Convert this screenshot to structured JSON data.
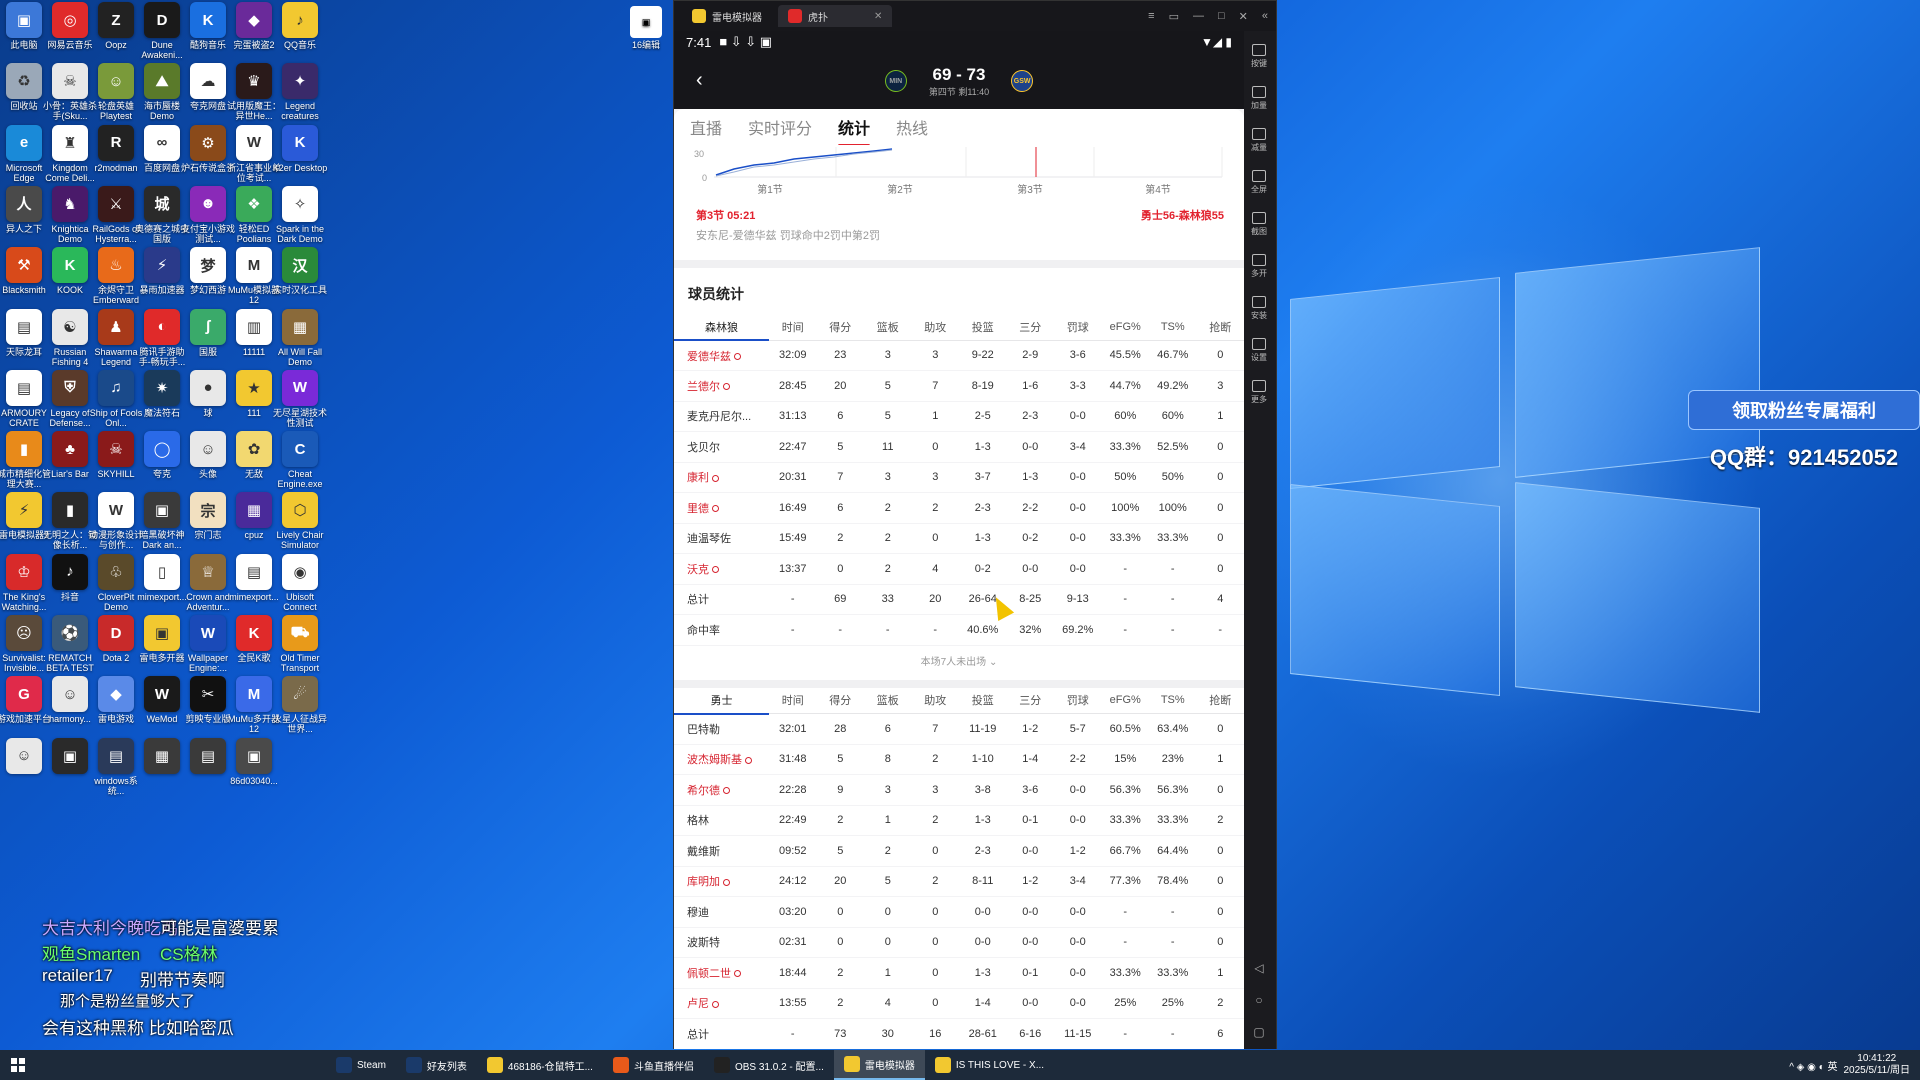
{
  "desktop": {
    "icons": [
      {
        "label": "此电脑",
        "color": "#3c78d8",
        "glyph": "▣"
      },
      {
        "label": "网易云音乐",
        "color": "#e02a2a",
        "glyph": "◎"
      },
      {
        "label": "Oopz",
        "color": "#222222",
        "glyph": "Z"
      },
      {
        "label": "Dune Awakeni...",
        "color": "#1a1a1a",
        "glyph": "D"
      },
      {
        "label": "酷狗音乐",
        "color": "#1a6fe0",
        "glyph": "K"
      },
      {
        "label": "完蛋被盗2",
        "color": "#6a2a9a",
        "glyph": "◆"
      },
      {
        "label": "QQ音乐",
        "color": "#f2c830",
        "glyph": "♪"
      },
      {
        "label": "回收站",
        "color": "#9aa8b8",
        "glyph": "♻"
      },
      {
        "label": "小骨：英雄杀手(Sku...",
        "color": "#e8e8e8",
        "glyph": "☠"
      },
      {
        "label": "轮盘英雄 Playtest",
        "color": "#7a9a3a",
        "glyph": "☺"
      },
      {
        "label": "海市蜃楼 Demo",
        "color": "#5a7a2a",
        "glyph": "⛰"
      },
      {
        "label": "夸克网盘",
        "color": "#ffffff",
        "glyph": "☁"
      },
      {
        "label": "试用版魔王：异世He...",
        "color": "#2a1a1a",
        "glyph": "♛"
      },
      {
        "label": "Legend creatures",
        "color": "#3a2a6a",
        "glyph": "✦"
      },
      {
        "label": "Microsoft Edge",
        "color": "#1a8ad8",
        "glyph": "e"
      },
      {
        "label": "Kingdom Come Deli...",
        "color": "#ffffff",
        "glyph": "♜"
      },
      {
        "label": "r2modman",
        "color": "#222222",
        "glyph": "R"
      },
      {
        "label": "百度网盘",
        "color": "#ffffff",
        "glyph": "∞"
      },
      {
        "label": "炉石传说盒子",
        "color": "#8a4a1a",
        "glyph": "⚙"
      },
      {
        "label": "浙江省事业单位考试...",
        "color": "#ffffff",
        "glyph": "W"
      },
      {
        "label": "K2er Desktop",
        "color": "#2a5ad8",
        "glyph": "K"
      },
      {
        "label": "异人之下",
        "color": "#4a4a4a",
        "glyph": "人"
      },
      {
        "label": "Knightica Demo",
        "color": "#4a1a6a",
        "glyph": "♞"
      },
      {
        "label": "RailGods of Hysterra...",
        "color": "#3a1a1a",
        "glyph": "⚔"
      },
      {
        "label": "奥德赛之城中国版",
        "color": "#2a2a2a",
        "glyph": "城"
      },
      {
        "label": "支付宝小游戏测试...",
        "color": "#8a2ab8",
        "glyph": "☻"
      },
      {
        "label": "轻松ED Poolians",
        "color": "#3aaa5a",
        "glyph": "❖"
      },
      {
        "label": "Spark in the Dark Demo",
        "color": "#ffffff",
        "glyph": "✧"
      },
      {
        "label": "Blacksmith",
        "color": "#d84a1a",
        "glyph": "⚒"
      },
      {
        "label": "KOOK",
        "color": "#2ab85a",
        "glyph": "K"
      },
      {
        "label": "余烬守卫 Emberward",
        "color": "#e86a1a",
        "glyph": "♨"
      },
      {
        "label": "暴雨加速器",
        "color": "#2a3a8a",
        "glyph": "⚡"
      },
      {
        "label": "梦幻西游",
        "color": "#ffffff",
        "glyph": "梦"
      },
      {
        "label": "MuMu模拟器12",
        "color": "#ffffff",
        "glyph": "M"
      },
      {
        "label": "实时汉化工具",
        "color": "#2a8a3a",
        "glyph": "汉"
      },
      {
        "label": "天际龙耳",
        "color": "#ffffff",
        "glyph": "▤"
      },
      {
        "label": "Russian Fishing 4",
        "color": "#e8e8e8",
        "glyph": "☯"
      },
      {
        "label": "Shawarma Legend",
        "color": "#a83a1a",
        "glyph": "♟"
      },
      {
        "label": "腾讯手游助手-畅玩手...",
        "color": "#e02a2a",
        "glyph": "◐"
      },
      {
        "label": "国服",
        "color": "#3aaa6a",
        "glyph": "ʃ"
      },
      {
        "label": "11111",
        "color": "#ffffff",
        "glyph": "▥"
      },
      {
        "label": "All Will Fall Demo",
        "color": "#8a6a3a",
        "glyph": "▦"
      },
      {
        "label": "ARMOURY CRATE",
        "color": "#ffffff",
        "glyph": "▤"
      },
      {
        "label": "Legacy of Defense...",
        "color": "#5a3a2a",
        "glyph": "⛨"
      },
      {
        "label": "Ship of Fools Onl...",
        "color": "#1a4a8a",
        "glyph": "♫"
      },
      {
        "label": "魔法符石",
        "color": "#1a3a5a",
        "glyph": "✷"
      },
      {
        "label": "球",
        "color": "#e8e8e8",
        "glyph": "●"
      },
      {
        "label": "111",
        "color": "#f2c830",
        "glyph": "★"
      },
      {
        "label": "无尽星湖技术性测试",
        "color": "#7a2ad8",
        "glyph": "W"
      },
      {
        "label": "城市精细化管理大赛...",
        "color": "#e88a1a",
        "glyph": "▮"
      },
      {
        "label": "Liar's Bar",
        "color": "#8a1a1a",
        "glyph": "♣"
      },
      {
        "label": "SKYHILL",
        "color": "#8a1a1a",
        "glyph": "☠"
      },
      {
        "label": "夸克",
        "color": "#2a6ae8",
        "glyph": "◯"
      },
      {
        "label": "头像",
        "color": "#e8e8e8",
        "glyph": "☺"
      },
      {
        "label": "无敌",
        "color": "#f2d870",
        "glyph": "✿"
      },
      {
        "label": "Cheat Engine.exe",
        "color": "#1a5ab8",
        "glyph": "C"
      },
      {
        "label": "雷电模拟器9",
        "color": "#f2c830",
        "glyph": "⚡"
      },
      {
        "label": "无明之人：镜像长析...",
        "color": "#2a2a2a",
        "glyph": "▮"
      },
      {
        "label": "动漫形象设计与创作...",
        "color": "#ffffff",
        "glyph": "W"
      },
      {
        "label": "暗黑破坏神 Dark an...",
        "color": "#3a3a3a",
        "glyph": "▣"
      },
      {
        "label": "宗门志",
        "color": "#f2e0c0",
        "glyph": "宗"
      },
      {
        "label": "cpuz",
        "color": "#4a2a9a",
        "glyph": "▦"
      },
      {
        "label": "Lively Chair Simulator",
        "color": "#f2c830",
        "glyph": "⬡"
      },
      {
        "label": "The King's Watching...",
        "color": "#d82a2a",
        "glyph": "♔"
      },
      {
        "label": "抖音",
        "color": "#111111",
        "glyph": "♪"
      },
      {
        "label": "CloverPit Demo",
        "color": "#5a4a2a",
        "glyph": "♧"
      },
      {
        "label": "mimexport...",
        "color": "#ffffff",
        "glyph": "▯"
      },
      {
        "label": "Crown and Adventur...",
        "color": "#8a6a3a",
        "glyph": "♕"
      },
      {
        "label": "mimexport...",
        "color": "#ffffff",
        "glyph": "▤"
      },
      {
        "label": "Ubisoft Connect",
        "color": "#ffffff",
        "glyph": "◉"
      },
      {
        "label": "Survivalist: Invisible...",
        "color": "#5a4a3a",
        "glyph": "☹"
      },
      {
        "label": "REMATCH BETA TEST",
        "color": "#3a5a7a",
        "glyph": "⚽"
      },
      {
        "label": "Dota 2",
        "color": "#c82a2a",
        "glyph": "D"
      },
      {
        "label": "雷电多开器",
        "color": "#f2c830",
        "glyph": "▣"
      },
      {
        "label": "Wallpaper Engine:...",
        "color": "#1a4ab8",
        "glyph": "W"
      },
      {
        "label": "全民K歌",
        "color": "#e02a2a",
        "glyph": "K"
      },
      {
        "label": "Old Timer Transport",
        "color": "#e89a1a",
        "glyph": "⛟"
      },
      {
        "label": "游戏加速平台",
        "color": "#e02a4a",
        "glyph": "G"
      },
      {
        "label": "harmony...",
        "color": "#e8e8e8",
        "glyph": "☺"
      },
      {
        "label": "雷电游戏",
        "color": "#5a8ae8",
        "glyph": "◆"
      },
      {
        "label": "WeMod",
        "color": "#1a1a1a",
        "glyph": "W"
      },
      {
        "label": "剪映专业版",
        "color": "#111111",
        "glyph": "✂"
      },
      {
        "label": "MuMu多开器12",
        "color": "#3a6ae8",
        "glyph": "M"
      },
      {
        "label": "火星人征战异世界...",
        "color": "#7a6a4a",
        "glyph": "☄"
      },
      {
        "label": "",
        "color": "#e8e8e8",
        "glyph": "☺"
      },
      {
        "label": "",
        "color": "#2a2a2a",
        "glyph": "▣"
      },
      {
        "label": "windows系统...",
        "color": "#2a3a5a",
        "glyph": "▤"
      },
      {
        "label": "",
        "color": "#3a3a3a",
        "glyph": "▦"
      },
      {
        "label": "",
        "color": "#3a3a3a",
        "glyph": "▤"
      },
      {
        "label": "86d03040...",
        "color": "#4a4a4a",
        "glyph": "▣"
      }
    ],
    "top_widget": {
      "label": "16编辑",
      "glyph": "▣"
    }
  },
  "overlay": {
    "lines": [
      {
        "text": "大吉大利今晚吃鸡",
        "color": "#c9a7ff"
      },
      {
        "text": "可能是富婆要累",
        "color": "#ffffff"
      },
      {
        "text": "观鱼Smarten",
        "color": "#6cff6c"
      },
      {
        "text": "CS格林",
        "color": "#6cff6c"
      },
      {
        "text": "retailer17",
        "color": "#ffffff"
      },
      {
        "text": "别带节奏啊",
        "color": "#ffffff"
      },
      {
        "text": "那个是粉丝量够大了",
        "color": "#ffffff"
      },
      {
        "text": "会有这种黑称 比如哈密瓜",
        "color": "#ffffff"
      }
    ]
  },
  "promo": {
    "button": "领取粉丝专属福利",
    "qq": "QQ群：921452052"
  },
  "emulator": {
    "tabs": [
      {
        "label": "雷电模拟器",
        "color": "#f2c830"
      },
      {
        "label": "虎扑",
        "color": "#e02a2a"
      }
    ],
    "side_buttons": [
      "按键",
      "加量",
      "减量",
      "全屏",
      "截图",
      "多开",
      "安装",
      "设置",
      "更多"
    ]
  },
  "phone": {
    "status": {
      "time": "7:41",
      "battery": "▮▯"
    },
    "game": {
      "score": "69 - 73",
      "period": "第四节 剩11:40",
      "home_abbr": "MIN",
      "away_abbr": "GSW"
    },
    "subtabs": [
      "直播",
      "实时评分",
      "统计",
      "热线"
    ],
    "active_subtab": "统计",
    "chart": {
      "y_labels": [
        "30",
        "0"
      ],
      "quarters": [
        "第1节",
        "第2节",
        "第3节",
        "第4节"
      ]
    },
    "play": {
      "time": "第3节 05:21",
      "score": "勇士56-森林狼55",
      "desc": "安东尼-爱德华兹 罚球命中2罚中第2罚"
    },
    "section_title": "球员统计",
    "columns": [
      "时间",
      "得分",
      "篮板",
      "助攻",
      "投篮",
      "三分",
      "罚球",
      "eFG%",
      "TS%",
      "抢断"
    ],
    "team1": {
      "name": "森林狼",
      "rows": [
        {
          "name": "爱德华兹",
          "starter": true,
          "vals": [
            "32:09",
            "23",
            "3",
            "3",
            "9-22",
            "2-9",
            "3-6",
            "45.5%",
            "46.7%",
            "0"
          ]
        },
        {
          "name": "兰德尔",
          "starter": true,
          "vals": [
            "28:45",
            "20",
            "5",
            "7",
            "8-19",
            "1-6",
            "3-3",
            "44.7%",
            "49.2%",
            "3"
          ]
        },
        {
          "name": "麦克丹尼尔...",
          "starter": false,
          "vals": [
            "31:13",
            "6",
            "5",
            "1",
            "2-5",
            "2-3",
            "0-0",
            "60%",
            "60%",
            "1"
          ]
        },
        {
          "name": "戈贝尔",
          "starter": false,
          "vals": [
            "22:47",
            "5",
            "11",
            "0",
            "1-3",
            "0-0",
            "3-4",
            "33.3%",
            "52.5%",
            "0"
          ]
        },
        {
          "name": "康利",
          "starter": true,
          "vals": [
            "20:31",
            "7",
            "3",
            "3",
            "3-7",
            "1-3",
            "0-0",
            "50%",
            "50%",
            "0"
          ]
        },
        {
          "name": "里德",
          "starter": true,
          "vals": [
            "16:49",
            "6",
            "2",
            "2",
            "2-3",
            "2-2",
            "0-0",
            "100%",
            "100%",
            "0"
          ]
        },
        {
          "name": "迪温琴佐",
          "starter": false,
          "vals": [
            "15:49",
            "2",
            "2",
            "0",
            "1-3",
            "0-2",
            "0-0",
            "33.3%",
            "33.3%",
            "0"
          ]
        },
        {
          "name": "沃克",
          "starter": true,
          "vals": [
            "13:37",
            "0",
            "2",
            "4",
            "0-2",
            "0-0",
            "0-0",
            "-",
            "-",
            "0"
          ]
        }
      ],
      "total": {
        "name": "总计",
        "vals": [
          "-",
          "69",
          "33",
          "20",
          "26-64",
          "8-25",
          "9-13",
          "-",
          "-",
          "4"
        ]
      },
      "pct": {
        "name": "命中率",
        "vals": [
          "-",
          "-",
          "-",
          "-",
          "40.6%",
          "32%",
          "69.2%",
          "-",
          "-",
          "-"
        ]
      },
      "bench_note": "本场7人未出场"
    },
    "team2": {
      "name": "勇士",
      "rows": [
        {
          "name": "巴特勒",
          "starter": false,
          "vals": [
            "32:01",
            "28",
            "6",
            "7",
            "11-19",
            "1-2",
            "5-7",
            "60.5%",
            "63.4%",
            "0"
          ]
        },
        {
          "name": "波杰姆斯基",
          "starter": true,
          "vals": [
            "31:48",
            "5",
            "8",
            "2",
            "1-10",
            "1-4",
            "2-2",
            "15%",
            "23%",
            "1"
          ]
        },
        {
          "name": "希尔德",
          "starter": true,
          "vals": [
            "22:28",
            "9",
            "3",
            "3",
            "3-8",
            "3-6",
            "0-0",
            "56.3%",
            "56.3%",
            "0"
          ]
        },
        {
          "name": "格林",
          "starter": false,
          "vals": [
            "22:49",
            "2",
            "1",
            "2",
            "1-3",
            "0-1",
            "0-0",
            "33.3%",
            "33.3%",
            "2"
          ]
        },
        {
          "name": "戴维斯",
          "starter": false,
          "vals": [
            "09:52",
            "5",
            "2",
            "0",
            "2-3",
            "0-0",
            "1-2",
            "66.7%",
            "64.4%",
            "0"
          ]
        },
        {
          "name": "库明加",
          "starter": true,
          "vals": [
            "24:12",
            "20",
            "5",
            "2",
            "8-11",
            "1-2",
            "3-4",
            "77.3%",
            "78.4%",
            "0"
          ]
        },
        {
          "name": "穆迪",
          "starter": false,
          "vals": [
            "03:20",
            "0",
            "0",
            "0",
            "0-0",
            "0-0",
            "0-0",
            "-",
            "-",
            "0"
          ]
        },
        {
          "name": "波斯特",
          "starter": false,
          "vals": [
            "02:31",
            "0",
            "0",
            "0",
            "0-0",
            "0-0",
            "0-0",
            "-",
            "-",
            "0"
          ]
        },
        {
          "name": "佩顿二世",
          "starter": true,
          "vals": [
            "18:44",
            "2",
            "1",
            "0",
            "1-3",
            "0-1",
            "0-0",
            "33.3%",
            "33.3%",
            "1"
          ]
        },
        {
          "name": "卢尼",
          "starter": true,
          "vals": [
            "13:55",
            "2",
            "4",
            "0",
            "1-4",
            "0-0",
            "0-0",
            "25%",
            "25%",
            "2"
          ]
        }
      ],
      "total": {
        "name": "总计",
        "vals": [
          "-",
          "73",
          "30",
          "16",
          "28-61",
          "6-16",
          "11-15",
          "-",
          "-",
          "6"
        ]
      }
    }
  },
  "taskbar": {
    "apps": [
      {
        "label": "Steam",
        "color": "#1a3a6a"
      },
      {
        "label": "好友列表",
        "color": "#1a3a6a"
      },
      {
        "label": "468186-仓鼠特工...",
        "color": "#f2c830"
      },
      {
        "label": "斗鱼直播伴侣",
        "color": "#e85a1a"
      },
      {
        "label": "OBS 31.0.2 - 配置...",
        "color": "#222222"
      },
      {
        "label": "雷电模拟器",
        "color": "#f2c830"
      },
      {
        "label": "IS THIS LOVE - X...",
        "color": "#f2c830"
      }
    ],
    "tray": "^ ◈ ◉ ◐ 英",
    "time": "10:41:22",
    "date": "2025/5/11/周日"
  }
}
